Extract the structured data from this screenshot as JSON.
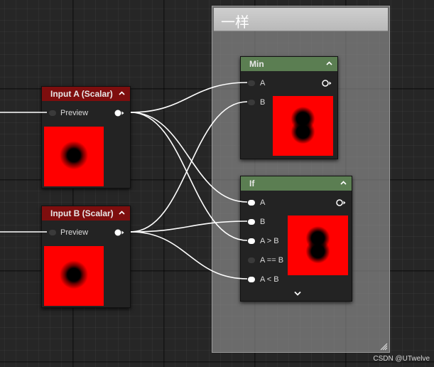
{
  "comment": {
    "title": "一样"
  },
  "nodes": {
    "input_a": {
      "title": "Input A (Scalar)",
      "preview_label": "Preview"
    },
    "input_b": {
      "title": "Input B (Scalar)",
      "preview_label": "Preview"
    },
    "min": {
      "title": "Min",
      "pins": [
        "A",
        "B"
      ]
    },
    "if": {
      "title": "If",
      "pins": [
        "A",
        "B",
        "A > B",
        "A == B",
        "A < B"
      ]
    }
  },
  "colors": {
    "input_header": "#7e0e0e",
    "math_header": "#5b7e52",
    "preview_fill": "#ff0000",
    "wire": "#ffffff"
  },
  "icons": [
    "chevron-up-icon",
    "chevron-down-icon",
    "output-pin-icon",
    "input-pin-icon",
    "resize-grip-icon"
  ],
  "watermark": "CSDN @UTwelve"
}
